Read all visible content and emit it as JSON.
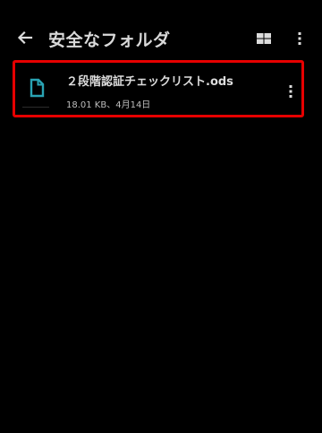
{
  "app_bar": {
    "title": "安全なフォルダ",
    "icons": {
      "back": "arrow-back-icon",
      "view": "grid-view-icon",
      "menu": "more-vert-icon"
    }
  },
  "files": [
    {
      "name": "２段階認証チェックリスト.ods",
      "meta": "18.01 KB、4月14日",
      "icon": "document-icon",
      "menu_icon": "more-vert-icon",
      "selected": true
    }
  ],
  "colors": {
    "background": "#000000",
    "highlight": "#e60000",
    "file_icon": "#29a3b3",
    "text_primary": "#dcdcdc",
    "text_secondary": "#bdbdbd"
  }
}
